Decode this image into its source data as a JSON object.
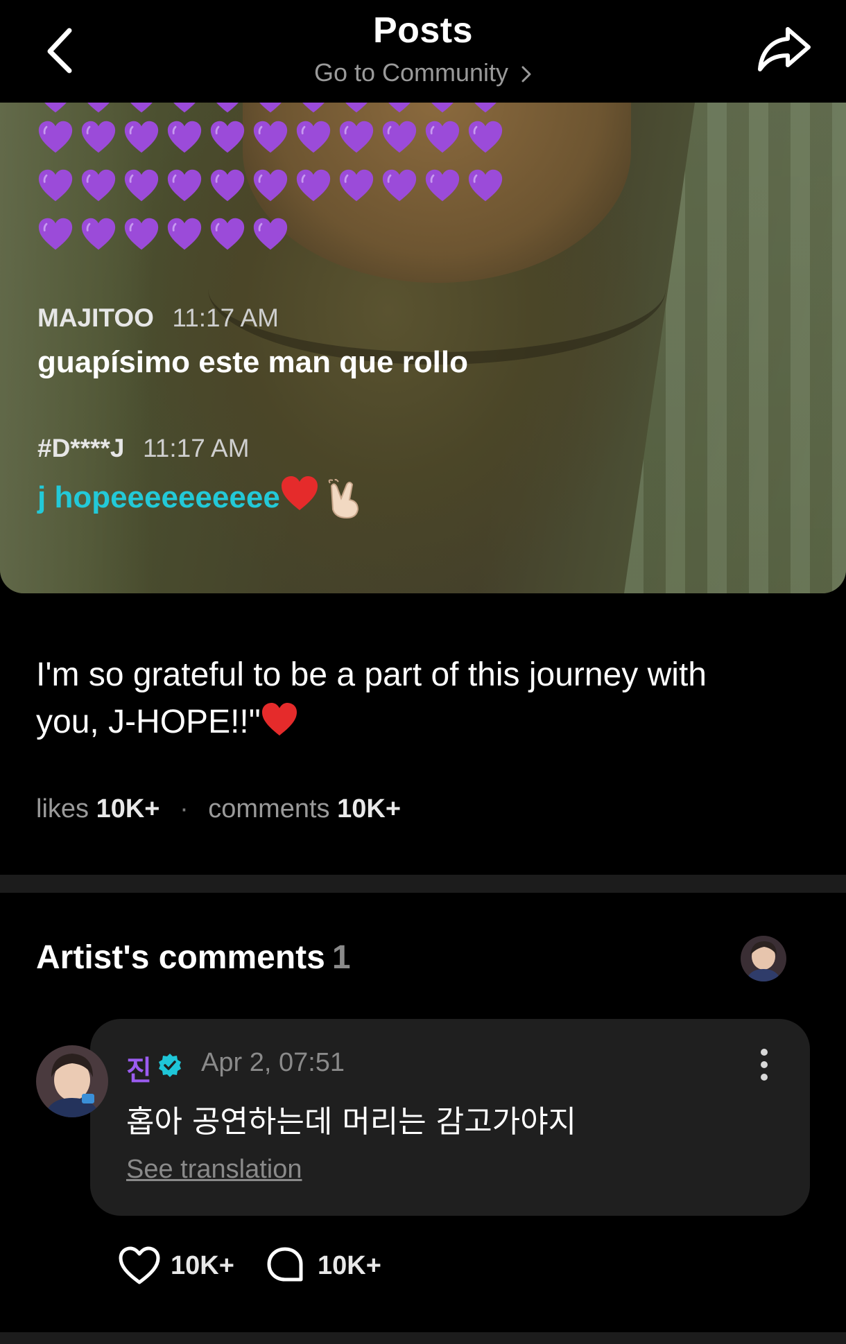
{
  "header": {
    "title": "Posts",
    "community_link": "Go to Community"
  },
  "photo": {
    "chat": [
      {
        "user": "MAJITOO",
        "time": "11:17 AM",
        "message": "guapísimo este man que rollo"
      },
      {
        "user": "#D****J",
        "time": "11:17 AM",
        "message": "j hopeeeeeeeeee"
      }
    ]
  },
  "post": {
    "text_line1": "I'm so grateful to be a part of this journey with",
    "text_line2": "you, J-HOPE!!\"",
    "likes_label": "likes",
    "likes_value": "10K+",
    "comments_label": "comments",
    "comments_value": "10K+"
  },
  "artist_comments": {
    "title": "Artist's comments",
    "count": "1",
    "comment": {
      "author": "진",
      "date": "Apr 2, 07:51",
      "text": "홉아 공연하는데 머리는 감고가야지",
      "translate_label": "See translation",
      "likes": "10K+",
      "replies": "10K+"
    }
  },
  "colors": {
    "background": "#000000",
    "heart_purple": "#9b4bd9",
    "chat_cyan": "#23c9d8",
    "artist_name": "#9b5cf0",
    "verified": "#1fc6d8",
    "muted_text": "#9a9a9a"
  },
  "icons": [
    "back-arrow-icon",
    "share-icon",
    "chevron-right-icon",
    "purple-heart-icon",
    "red-heart-icon",
    "finger-heart-icon",
    "verified-icon",
    "more-vertical-icon",
    "like-heart-icon",
    "comment-bubble-icon"
  ]
}
